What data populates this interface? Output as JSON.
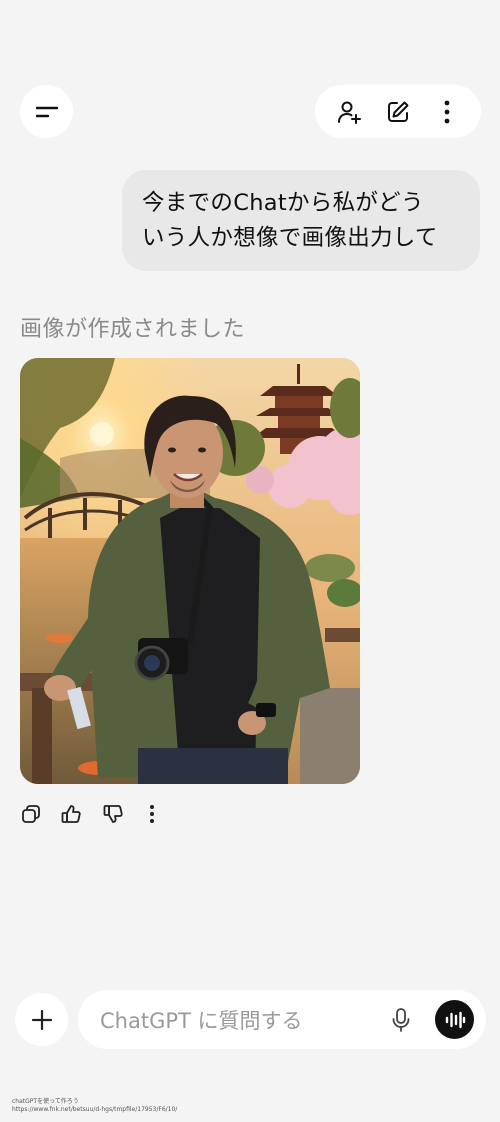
{
  "header": {
    "menu_icon": "menu-icon",
    "actions": [
      "add-person-icon",
      "edit-icon",
      "more-vertical-icon"
    ]
  },
  "conversation": {
    "user_message_lines": [
      "今までのChatから私がどう",
      "いう人か想像で画像出力して"
    ],
    "status_text": "画像が作成されました",
    "image": {
      "subject": "smiling man with camera in Japanese garden at sunset",
      "elements": [
        "pagoda",
        "cherry blossoms",
        "arched bridge",
        "pond",
        "setting sun"
      ]
    },
    "message_actions": [
      "copy-icon",
      "thumbs-up-icon",
      "thumbs-down-icon",
      "more-vertical-icon"
    ]
  },
  "composer": {
    "placeholder": "ChatGPT に質問する",
    "value": "",
    "icons": [
      "plus-icon",
      "mic-icon",
      "voice-mode-icon"
    ]
  },
  "watermark": {
    "line1": "chatGPTを使って作ろう",
    "line2": "https://www.fnk.net/betsuu/d-hgs/tmpfile/17953/F6/10/"
  },
  "colors": {
    "background": "#f4f4f4",
    "bubble": "#e8e8e8",
    "status_text": "#8a8a8a",
    "voice_button": "#111111"
  }
}
